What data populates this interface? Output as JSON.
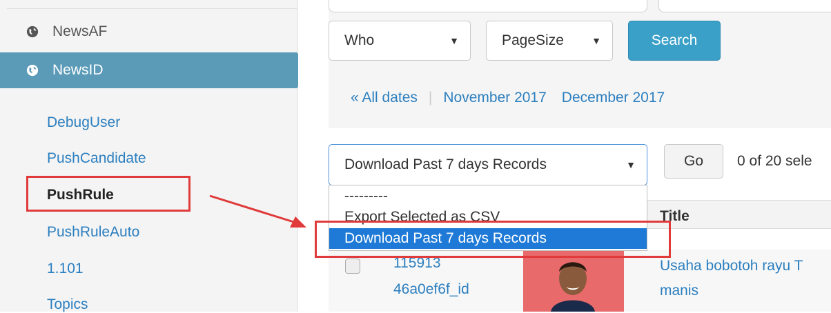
{
  "sidebar": {
    "apps": [
      {
        "label": "NewsAF",
        "icon": "globe-icon"
      },
      {
        "label": "NewsID",
        "icon": "globe-icon",
        "active": true
      }
    ],
    "models": [
      {
        "label": "DebugUser"
      },
      {
        "label": "PushCandidate"
      },
      {
        "label": "PushRule",
        "highlighted": true
      },
      {
        "label": "PushRuleAuto"
      },
      {
        "label": "1.101"
      },
      {
        "label": "Topics"
      }
    ]
  },
  "filters": {
    "who": {
      "label": "Who"
    },
    "page_size": {
      "label": "PageSize"
    },
    "search_button": "Search"
  },
  "date_hierarchy": {
    "all_dates": "« All dates",
    "months": [
      "November 2017",
      "December 2017"
    ]
  },
  "actions": {
    "selected": "Download Past 7 days Records",
    "options": [
      "---------",
      "Export Selected as CSV",
      "Download Past 7 days Records"
    ],
    "go_button": "Go",
    "selection_counter": "0 of 20 sele"
  },
  "table": {
    "columns": [
      "Title"
    ],
    "rows": [
      {
        "id_line1": "115913",
        "id_line2": "46a0ef6f_id",
        "title_line1": "Usaha bobotoh rayu T",
        "title_line2": "manis"
      }
    ]
  },
  "colors": {
    "accent": "#5b9bb8",
    "link": "#2c7fbf",
    "search_button": "#3aa0c8",
    "highlight_box": "#e03a3a",
    "selected_option": "#1e7ad6"
  }
}
